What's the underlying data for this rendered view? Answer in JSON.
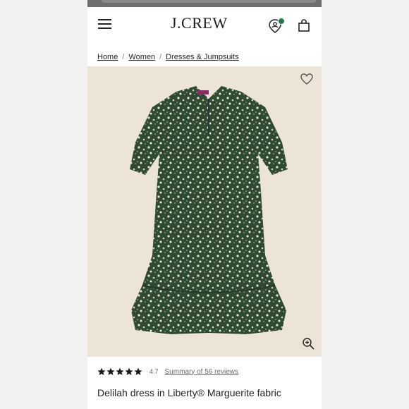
{
  "header": {
    "logo": "J.CREW",
    "menu_icon": "hamburger-menu-icon",
    "store_icon": "store-locator-icon",
    "bag_icon": "shopping-bag-icon"
  },
  "breadcrumb": {
    "items": [
      {
        "label": "Home"
      },
      {
        "label": "Women"
      },
      {
        "label": "Dresses & Jumpsuits"
      }
    ],
    "separator": "/"
  },
  "product": {
    "image_bg": "#ece4d6",
    "title": "Delilah dress in Liberty® Marguerite fabric",
    "rating": {
      "stars_filled": 5,
      "value": "4.7",
      "summary_link": "Summary of 56 reviews"
    },
    "wishlist_icon": "heart-icon",
    "zoom_icon": "zoom-in-icon"
  }
}
